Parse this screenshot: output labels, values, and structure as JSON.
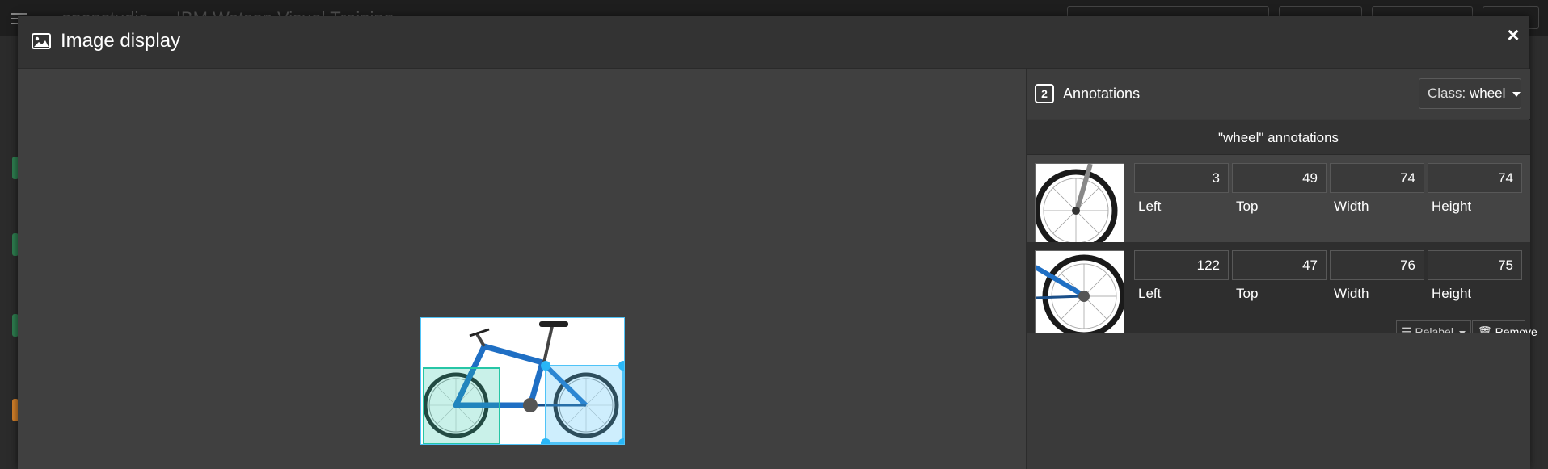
{
  "modal": {
    "title": "Image display",
    "title_icon": "image-icon",
    "close_label": "×"
  },
  "background_app": {
    "title": "openstudio — IBM Watson Visual Training"
  },
  "side_panel": {
    "annotation_count": "2",
    "title": "Annotations",
    "class_label_prefix": "Class:",
    "class_value": "wheel",
    "section_heading": "\"wheel\" annotations"
  },
  "annotations": [
    {
      "left": "3",
      "top": "49",
      "width": "74",
      "height": "74"
    },
    {
      "left": "122",
      "top": "47",
      "width": "76",
      "height": "75"
    }
  ],
  "field_labels": {
    "left": "Left",
    "top": "Top",
    "width": "Width",
    "height": "Height"
  },
  "actions": {
    "relabel": "Relabel",
    "remove": "Remove"
  },
  "colors": {
    "box_selected": "#4fc3f7",
    "box_other": "#26c6a6",
    "bike_frame": "#1f6fc4"
  }
}
